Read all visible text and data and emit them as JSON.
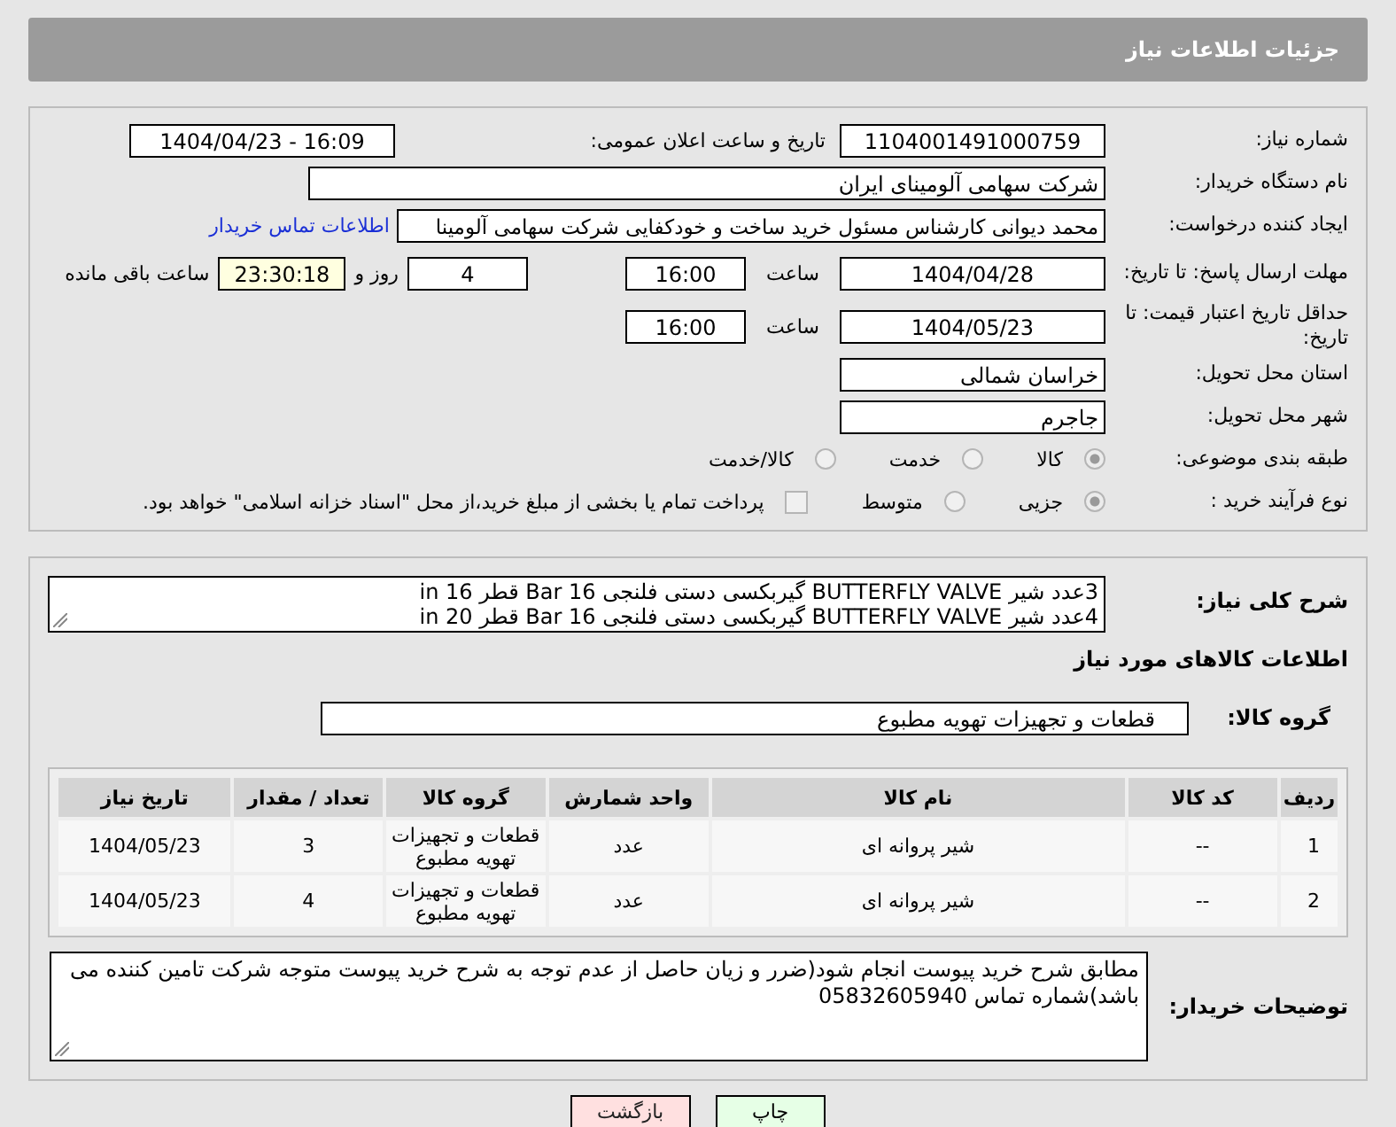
{
  "title": "جزئیات اطلاعات نیاز",
  "need_number": {
    "label": "شماره نیاز:",
    "value": "1104001491000759"
  },
  "announce": {
    "label": "تاریخ و ساعت اعلان عمومی:",
    "value": "1404/04/23 - 16:09"
  },
  "buyer_org": {
    "label": "نام دستگاه خریدار:",
    "value": "شرکت سهامی آلومینای ایران"
  },
  "requester": {
    "label": "ایجاد کننده درخواست:",
    "value": "محمد دیوانی کارشناس مسئول خرید ساخت و خودکفایی شرکت سهامی آلومینا",
    "link": "اطلاعات تماس خریدار"
  },
  "reply_deadline": {
    "label": "مهلت ارسال پاسخ: تا تاریخ:",
    "date": "1404/04/28",
    "time_label": "ساعت",
    "time": "16:00",
    "days": "4",
    "days_label": "روز و",
    "remaining": "23:30:18",
    "remaining_label": "ساعت باقی مانده"
  },
  "price_validity": {
    "label": "حداقل تاریخ اعتبار قیمت: تا تاریخ:",
    "date": "1404/05/23",
    "time_label": "ساعت",
    "time": "16:00"
  },
  "province": {
    "label": "استان محل تحویل:",
    "value": "خراسان شمالی"
  },
  "city": {
    "label": "شهر محل تحویل:",
    "value": "جاجرم"
  },
  "category": {
    "label": "طبقه بندی موضوعی:",
    "options": [
      {
        "label": "کالا",
        "selected": true
      },
      {
        "label": "خدمت",
        "selected": false
      },
      {
        "label": "کالا/خدمت",
        "selected": false
      }
    ]
  },
  "process": {
    "label": "نوع فرآیند خرید :",
    "options": [
      {
        "label": "جزیی",
        "selected": true
      },
      {
        "label": "متوسط",
        "selected": false
      }
    ],
    "payment": {
      "label": "پرداخت تمام یا بخشی از مبلغ خرید،از محل \"اسناد خزانه اسلامی\" خواهد بود.",
      "checked": false
    }
  },
  "description": {
    "label": "شرح کلی نیاز:",
    "lines": [
      "3عدد شیر BUTTERFLY VALVE گیربکسی دستی فلنجی 16 Bar قطر 16 in",
      "4عدد شیر BUTTERFLY VALVE گیربکسی دستی فلنجی 16 Bar قطر 20 in"
    ]
  },
  "goods_title": "اطلاعات کالاهای مورد نیاز",
  "goods_group": {
    "label": "گروه کالا:",
    "value": "قطعات و تجهیزات تهویه مطبوع"
  },
  "table": {
    "columns": [
      "ردیف",
      "کد کالا",
      "نام کالا",
      "واحد شمارش",
      "گروه کالا",
      "تعداد / مقدار",
      "تاریخ نیاز"
    ],
    "rows": [
      [
        "1",
        "--",
        "شیر پروانه ای",
        "عدد",
        "قطعات و تجهیزات تهویه مطبوع",
        "3",
        "1404/05/23"
      ],
      [
        "2",
        "--",
        "شیر پروانه ای",
        "عدد",
        "قطعات و تجهیزات تهویه مطبوع",
        "4",
        "1404/05/23"
      ]
    ]
  },
  "buyer_notes": {
    "label": "توضیحات خریدار:",
    "value": "مطابق شرح خرید پیوست انجام شود(ضرر و زیان حاصل از عدم توجه به شرح خرید پیوست متوجه شرکت تامین کننده می باشد)شماره تماس 05832605940"
  },
  "buttons": [
    {
      "label": "چاپ",
      "kind": "print"
    },
    {
      "label": "بازگشت",
      "kind": "back"
    }
  ]
}
